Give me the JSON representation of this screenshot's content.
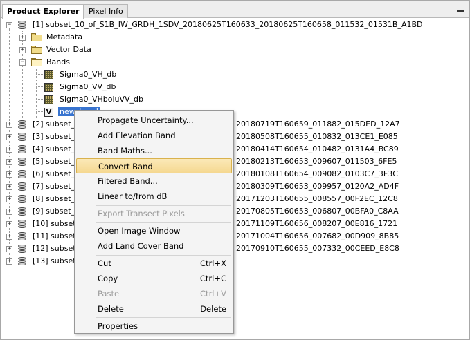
{
  "tabs": [
    {
      "label": "Product Explorer",
      "active": true
    },
    {
      "label": "Pixel Info",
      "active": false
    }
  ],
  "tree": {
    "p1": {
      "label": "[1] subset_10_of_S1B_IW_GRDH_1SDV_20180625T160633_20180625T160658_011532_01531B_A1BD"
    },
    "metadata": "Metadata",
    "vector_data": "Vector Data",
    "bands_folder": "Bands",
    "bands": [
      "Sigma0_VH_db",
      "Sigma0_VV_db",
      "Sigma0_VHboluVV_db"
    ],
    "new_band": "new_band",
    "products": [
      {
        "left": "[2] subset_",
        "right": "20180719T160659_011882_015DED_12A7"
      },
      {
        "left": "[3] subset_9",
        "right": "20180508T160655_010832_013CE1_E085"
      },
      {
        "left": "[4] subset_8",
        "right": "20180414T160654_010482_0131A4_BC89"
      },
      {
        "left": "[5] subset_6",
        "right": "20180213T160653_009607_011503_6FE5"
      },
      {
        "left": "[6] subset_5",
        "right": "20180108T160654_009082_0103C7_3F3C"
      },
      {
        "left": "[7] subset_7",
        "right": "20180309T160653_009957_0120A2_AD4F"
      },
      {
        "left": "[8] subset_4",
        "right": "20171203T160655_008557_00F2EC_12C8"
      },
      {
        "left": "[9] subset_0",
        "right": "20170805T160653_006807_00BFA0_C8AA"
      },
      {
        "left": "[10] subset_",
        "right": "20171109T160656_008207_00E816_1721"
      },
      {
        "left": "[11] subset_",
        "right": "20171004T160656_007682_00D909_8B85"
      },
      {
        "left": "[12] subset_",
        "right": "20170910T160655_007332_00CEED_E8C8"
      },
      {
        "left": "[13] subset_",
        "right": ""
      }
    ]
  },
  "context_menu": {
    "items": [
      {
        "label": "Propagate Uncertainty...",
        "shortcut": "",
        "disabled": false
      },
      {
        "label": "Add Elevation Band",
        "shortcut": "",
        "disabled": false
      },
      {
        "label": "Band Maths...",
        "shortcut": "",
        "disabled": false
      },
      {
        "label": "Convert Band",
        "shortcut": "",
        "disabled": false,
        "highlighted": true
      },
      {
        "label": "Filtered Band...",
        "shortcut": "",
        "disabled": false
      },
      {
        "label": "Linear to/from dB",
        "shortcut": "",
        "disabled": false
      },
      {
        "label": "Export Transect Pixels",
        "shortcut": "",
        "disabled": true
      },
      {
        "label": "Open Image Window",
        "shortcut": "",
        "disabled": false
      },
      {
        "label": "Add Land Cover Band",
        "shortcut": "",
        "disabled": false
      },
      {
        "label": "Cut",
        "shortcut": "Ctrl+X",
        "disabled": false
      },
      {
        "label": "Copy",
        "shortcut": "Ctrl+C",
        "disabled": false
      },
      {
        "label": "Paste",
        "shortcut": "Ctrl+V",
        "disabled": true
      },
      {
        "label": "Delete",
        "shortcut": "Delete",
        "disabled": false
      },
      {
        "label": "Properties",
        "shortcut": "",
        "disabled": false
      }
    ]
  },
  "colors": {
    "selection": "#3874d0",
    "menu_highlight": "#f5d890"
  }
}
